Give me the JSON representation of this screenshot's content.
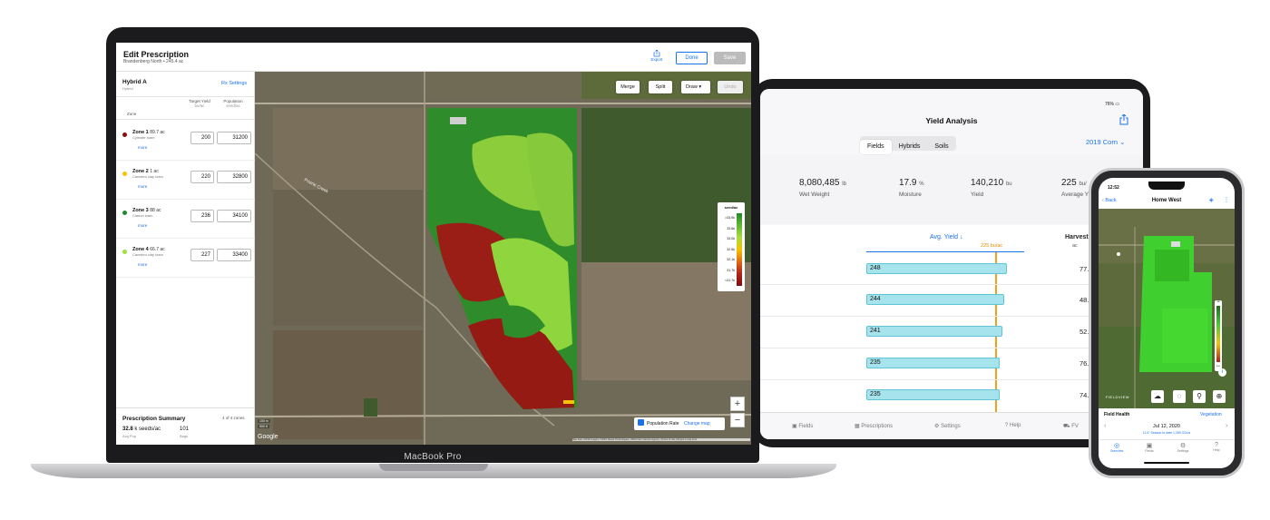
{
  "laptop": {
    "brand_label": "MacBook Pro",
    "header": {
      "title": "Edit Prescription",
      "subtitle": "Brandenberg North • 245.4 ac",
      "export_label": "Export",
      "done_label": "Done",
      "save_label": "Save"
    },
    "panel": {
      "hybrid": "Hybrid A",
      "hybrid_sub": "Hybrid",
      "rx_settings": "Rx Settings",
      "col_zone": "Zone",
      "col_target": "Target Yield",
      "col_target_unit": "bu/ac",
      "col_pop": "Population",
      "col_pop_unit": "seed/ac",
      "zones": [
        {
          "name": "Zone 1",
          "acres": "89.7 ac",
          "soil": "Cylinder loam",
          "more": "more",
          "yield": "200",
          "population": "31200",
          "color": "#8b0e0e"
        },
        {
          "name": "Zone 2",
          "acres": "1 ac",
          "soil": "Canisteo clay loam",
          "more": "more",
          "yield": "220",
          "population": "32800",
          "color": "#f4c400"
        },
        {
          "name": "Zone 3",
          "acres": "88 ac",
          "soil": "Clarion loam",
          "more": "more",
          "yield": "236",
          "population": "34100",
          "color": "#1f8a2a"
        },
        {
          "name": "Zone 4",
          "acres": "66.7 ac",
          "soil": "Canisteo clay loam",
          "more": "more",
          "yield": "227",
          "population": "33400",
          "color": "#9be23a"
        }
      ],
      "summary": {
        "title": "Prescription Summary",
        "count": "4 of 4 zones",
        "pop_value": "32.8",
        "pop_unit": "k seeds/ac",
        "pop_label": "Avg Pop",
        "bags_value": "101",
        "bags_label": "Bags"
      }
    },
    "map": {
      "buttons": {
        "merge": "Merge",
        "split": "Split",
        "draw": "Draw",
        "undo": "Undo"
      },
      "legend": {
        "title": "seed/ac",
        "items": [
          ">33.9k",
          "33.6k",
          "33.0k",
          "32.6k",
          "32.1k",
          "31.7k",
          "<31.7k"
        ]
      },
      "population_rate": "Population Rate",
      "change_map": "Change map",
      "road_label": "Prairie Creek",
      "scale_1": "100 m",
      "scale_2": "500 ft",
      "google": "Google",
      "attribution": "Map data ©2019 Imagery ©2019, Maxar Technologies, USDA Farm Service Agency | Terms of Use | Report a map error",
      "zoom_in": "+",
      "zoom_out": "−"
    }
  },
  "ipad": {
    "status_battery": "76%",
    "title": "Yield Analysis",
    "segments": [
      "Fields",
      "Hybrids",
      "Soils"
    ],
    "season": "2019 Corn",
    "stats": [
      {
        "value": "8,080,485",
        "unit": "lb",
        "label": "Wet Weight"
      },
      {
        "value": "17.9",
        "unit": "%",
        "label": "Moisture"
      },
      {
        "value": "140,210",
        "unit": "bu",
        "label": "Yield"
      },
      {
        "value": "225",
        "unit": "bu/",
        "label": "Average Y"
      }
    ],
    "avg_yield_header": "Avg. Yield",
    "avg_marker": "225 bu/ac",
    "harvest_header": "Harvest",
    "harvest_unit": "ac",
    "rows": [
      {
        "yield": "248",
        "harvest": "77.5"
      },
      {
        "yield": "244",
        "harvest": "48.3"
      },
      {
        "yield": "241",
        "harvest": "52.4"
      },
      {
        "yield": "235",
        "harvest": "76.9"
      },
      {
        "yield": "235",
        "harvest": "74.8"
      }
    ],
    "tabs": [
      "Fields",
      "Prescriptions",
      "Settings",
      "Help",
      "FV"
    ]
  },
  "phone": {
    "time": "12:52",
    "back": "Back",
    "title": "Home West",
    "field_health": "Field Health",
    "vegetation": "Vegetation",
    "date": "Jul 12, 2020",
    "season_info": "11.6\" Season to date   1,359 GDUs",
    "legend_hi": "Hi",
    "legend_lo": "Lo",
    "watermark": "FIELDVIEW",
    "tabs": [
      "Overview",
      "Fields",
      "Settings",
      "Help"
    ]
  }
}
